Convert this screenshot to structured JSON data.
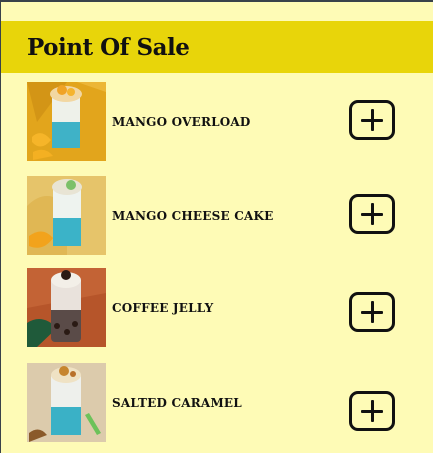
{
  "header": {
    "title": "Point Of Sale"
  },
  "products": [
    {
      "name": "MANGO OVERLOAD",
      "image": "mango-overload-drink-photo",
      "bg": "#e0a21a",
      "accent": "#f5b62a"
    },
    {
      "name": "MANGO CHEESE CAKE",
      "image": "mango-cheese-cake-drink-photo",
      "bg": "#e3c36a",
      "accent": "#f0a520"
    },
    {
      "name": "COFFEE JELLY",
      "image": "coffee-jelly-drink-photo",
      "bg": "#b8562a",
      "accent": "#2e1a12"
    },
    {
      "name": "SALTED CARAMEL",
      "image": "salted-caramel-drink-photo",
      "bg": "#d9c8a8",
      "accent": "#c8893a"
    }
  ],
  "actions": {
    "add_icon": "plus-square-icon"
  },
  "colors": {
    "background": "#fefbb6",
    "header": "#e8d50a",
    "text": "#111111"
  }
}
